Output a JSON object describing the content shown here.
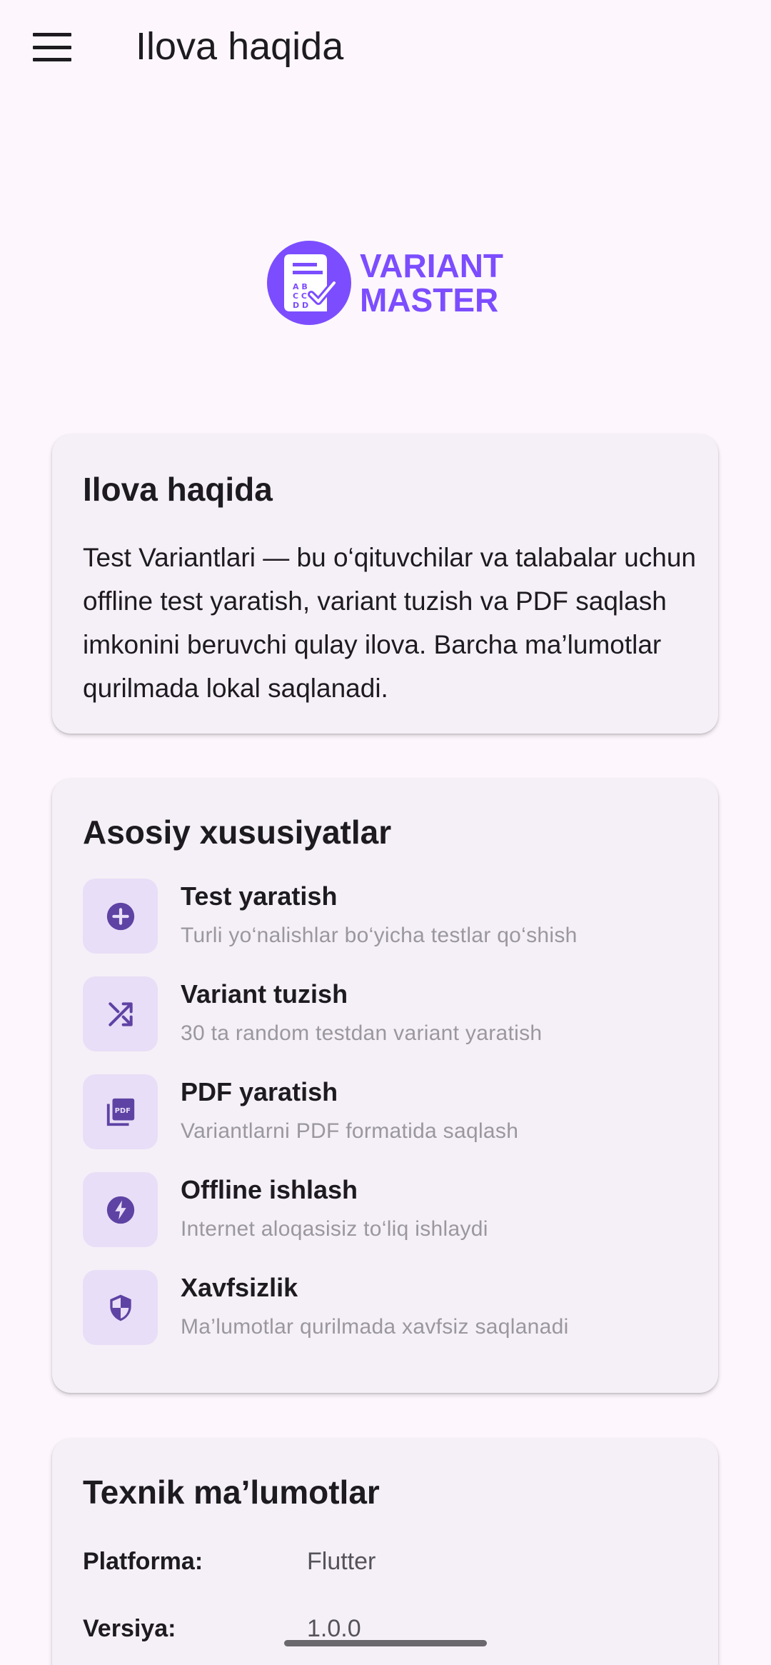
{
  "appbar": {
    "title": "Ilova haqida",
    "menu_icon": "menu-icon"
  },
  "logo": {
    "line1": "VARIANT",
    "line2": "MASTER",
    "sheet_letters": "A B\nC C\nD D",
    "color": "#7c4dff"
  },
  "about": {
    "title": "Ilova haqida",
    "text": "Test Variantlari — bu o‘qituvchilar va talabalar uchun offline test yaratish, variant tuzish va PDF saqlash imkonini beruvchi qulay ilova. Barcha ma’lumotlar qurilmada lokal saqlanadi."
  },
  "features": {
    "title": "Asosiy xususiyatlar",
    "items": [
      {
        "title": "Test yaratish",
        "subtitle": "Turli yo‘nalishlar bo‘yicha testlar qo‘shish",
        "icon": "add-circle-icon"
      },
      {
        "title": "Variant tuzish",
        "subtitle": "30 ta random testdan variant yaratish",
        "icon": "shuffle-icon"
      },
      {
        "title": "PDF yaratish",
        "subtitle": "Variantlarni PDF formatida saqlash",
        "icon": "pdf-icon"
      },
      {
        "title": "Offline ishlash",
        "subtitle": "Internet aloqasisiz to‘liq ishlaydi",
        "icon": "bolt-icon"
      },
      {
        "title": "Xavfsizlik",
        "subtitle": "Ma’lumotlar qurilmada xavfsiz saqlanadi",
        "icon": "shield-icon"
      }
    ],
    "icon_color": "#5e43a4",
    "icon_bg": "#e8def7"
  },
  "tech": {
    "title": "Texnik ma’lumotlar",
    "rows": [
      {
        "label": "Platforma:",
        "value": "Flutter"
      },
      {
        "label": "Versiya:",
        "value": "1.0.0"
      }
    ]
  }
}
